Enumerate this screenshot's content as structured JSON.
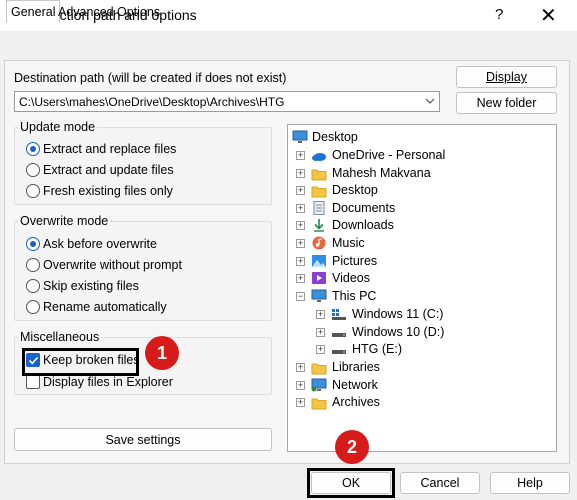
{
  "window": {
    "title": "Extraction path and options",
    "help": "?",
    "close": "✕"
  },
  "tabs": [
    {
      "label": "General"
    },
    {
      "label": "Advanced"
    },
    {
      "label": "Options"
    }
  ],
  "destination": {
    "label": "Destination path (will be created if does not exist)",
    "value": "C:\\Users\\mahes\\OneDrive\\Desktop\\Archives\\HTG"
  },
  "buttons": {
    "display": "Display",
    "new_folder": "New folder",
    "save_settings": "Save settings",
    "ok": "OK",
    "cancel": "Cancel",
    "help": "Help"
  },
  "update_mode": {
    "title": "Update mode",
    "options": [
      {
        "label": "Extract and replace files",
        "selected": true
      },
      {
        "label": "Extract and update files",
        "selected": false
      },
      {
        "label": "Fresh existing files only",
        "selected": false
      }
    ]
  },
  "overwrite_mode": {
    "title": "Overwrite mode",
    "options": [
      {
        "label": "Ask before overwrite",
        "selected": true
      },
      {
        "label": "Overwrite without prompt",
        "selected": false
      },
      {
        "label": "Skip existing files",
        "selected": false
      },
      {
        "label": "Rename automatically",
        "selected": false
      }
    ]
  },
  "miscellaneous": {
    "title": "Miscellaneous",
    "options": [
      {
        "label": "Keep broken files",
        "checked": true
      },
      {
        "label": "Display files in Explorer",
        "checked": false
      }
    ]
  },
  "tree": {
    "root": "Desktop",
    "items": [
      {
        "label": "OneDrive - Personal",
        "icon": "cloud-icon",
        "expander": "+"
      },
      {
        "label": "Mahesh Makvana",
        "icon": "folder-icon",
        "expander": "+"
      },
      {
        "label": "Desktop",
        "icon": "folder-icon",
        "expander": "+"
      },
      {
        "label": "Documents",
        "icon": "document-icon",
        "expander": "+"
      },
      {
        "label": "Downloads",
        "icon": "download-icon",
        "expander": "+"
      },
      {
        "label": "Music",
        "icon": "music-icon",
        "expander": "+"
      },
      {
        "label": "Pictures",
        "icon": "pictures-icon",
        "expander": "+"
      },
      {
        "label": "Videos",
        "icon": "videos-icon",
        "expander": "+"
      },
      {
        "label": "This PC",
        "icon": "monitor-icon",
        "expander": "−"
      },
      {
        "label": "Windows 11 (C:)",
        "icon": "system-drive-icon",
        "expander": "+"
      },
      {
        "label": "Windows 10 (D:)",
        "icon": "drive-icon",
        "expander": "+"
      },
      {
        "label": "HTG (E:)",
        "icon": "drive-icon",
        "expander": "+"
      },
      {
        "label": "Libraries",
        "icon": "folder-icon",
        "expander": "+"
      },
      {
        "label": "Network",
        "icon": "network-icon",
        "expander": "+"
      },
      {
        "label": "Archives",
        "icon": "folder-icon",
        "expander": "+"
      }
    ]
  },
  "annotations": {
    "step1": "1",
    "step2": "2"
  },
  "colors": {
    "accent": "#1a62c7",
    "badge": "#d71b1b"
  }
}
